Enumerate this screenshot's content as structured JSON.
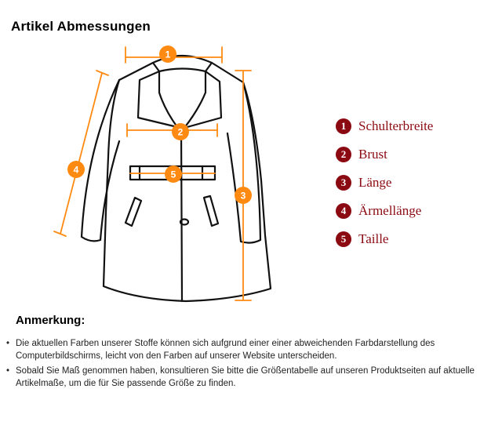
{
  "title": "Artikel Abmessungen",
  "colors": {
    "orange": "#ff8a12",
    "legend_red": "#8b0a12",
    "outline": "#111111"
  },
  "diagram": {
    "badges": [
      "1",
      "2",
      "3",
      "4",
      "5"
    ]
  },
  "legend": [
    {
      "number": "1",
      "label": "Schulterbreite"
    },
    {
      "number": "2",
      "label": "Brust"
    },
    {
      "number": "3",
      "label": "Länge"
    },
    {
      "number": "4",
      "label": "Ärmellänge"
    },
    {
      "number": "5",
      "label": "Taille"
    }
  ],
  "notes": {
    "title": "Anmerkung:",
    "bullet": "•",
    "items": [
      "Die aktuellen Farben unserer Stoffe können sich aufgrund einer einer abweichenden Farbdarstellung des Computerbildschirms, leicht von den Farben auf unserer Website unterscheiden.",
      "Sobald Sie Maß genommen haben, konsultieren Sie bitte die Größentabelle auf unseren Produktseiten auf aktuelle Artikelmaße, um die für Sie passende Größe zu finden."
    ]
  }
}
